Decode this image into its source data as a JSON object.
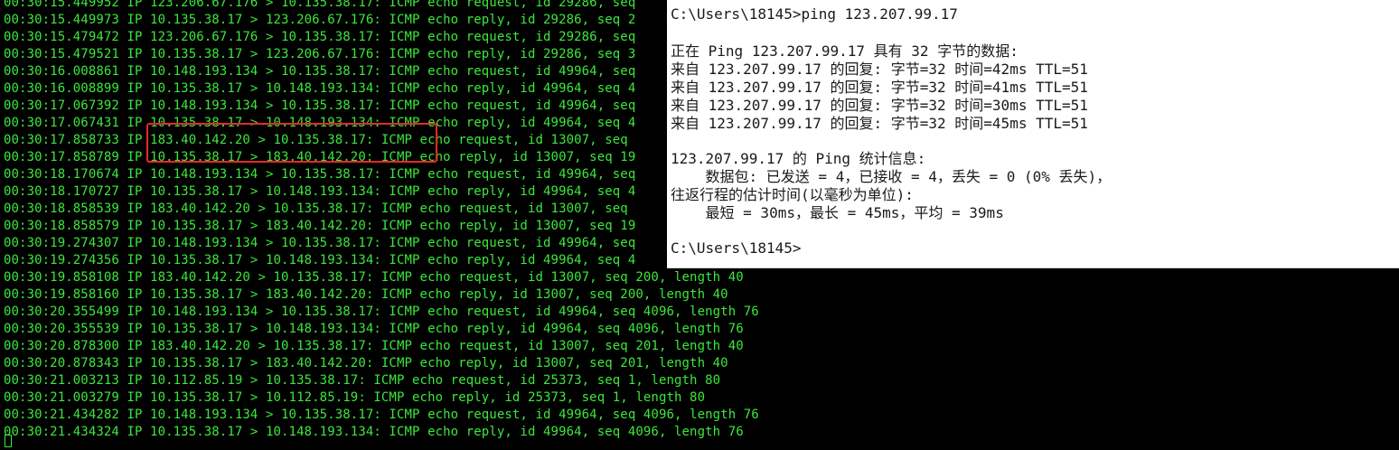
{
  "terminal": {
    "lines": [
      "00:30:15.449952 IP 123.206.67.176 > 10.135.38.17: ICMP echo request, id 29286, seq",
      "00:30:15.449973 IP 10.135.38.17 > 123.206.67.176: ICMP echo reply, id 29286, seq 2",
      "00:30:15.479472 IP 123.206.67.176 > 10.135.38.17: ICMP echo request, id 29286, seq",
      "00:30:15.479521 IP 10.135.38.17 > 123.206.67.176: ICMP echo reply, id 29286, seq 3",
      "00:30:16.008861 IP 10.148.193.134 > 10.135.38.17: ICMP echo request, id 49964, seq",
      "00:30:16.008899 IP 10.135.38.17 > 10.148.193.134: ICMP echo reply, id 49964, seq 4",
      "00:30:17.067392 IP 10.148.193.134 > 10.135.38.17: ICMP echo request, id 49964, seq",
      "00:30:17.067431 IP 10.135.38.17 > 10.148.193.134: ICMP echo reply, id 49964, seq 4",
      "00:30:17.858733 IP 183.40.142.20 > 10.135.38.17: ICMP echo request, id 13007, seq",
      "00:30:17.858789 IP 10.135.38.17 > 183.40.142.20: ICMP echo reply, id 13007, seq 19",
      "00:30:18.170674 IP 10.148.193.134 > 10.135.38.17: ICMP echo request, id 49964, seq",
      "00:30:18.170727 IP 10.135.38.17 > 10.148.193.134: ICMP echo reply, id 49964, seq 4",
      "00:30:18.858539 IP 183.40.142.20 > 10.135.38.17: ICMP echo request, id 13007, seq",
      "00:30:18.858579 IP 10.135.38.17 > 183.40.142.20: ICMP echo reply, id 13007, seq 19",
      "00:30:19.274307 IP 10.148.193.134 > 10.135.38.17: ICMP echo request, id 49964, seq",
      "00:30:19.274356 IP 10.135.38.17 > 10.148.193.134: ICMP echo reply, id 49964, seq 4",
      "00:30:19.858108 IP 183.40.142.20 > 10.135.38.17: ICMP echo request, id 13007, seq 200, length 40",
      "00:30:19.858160 IP 10.135.38.17 > 183.40.142.20: ICMP echo reply, id 13007, seq 200, length 40",
      "00:30:20.355499 IP 10.148.193.134 > 10.135.38.17: ICMP echo request, id 49964, seq 4096, length 76",
      "00:30:20.355539 IP 10.135.38.17 > 10.148.193.134: ICMP echo reply, id 49964, seq 4096, length 76",
      "00:30:20.878300 IP 183.40.142.20 > 10.135.38.17: ICMP echo request, id 13007, seq 201, length 40",
      "00:30:20.878343 IP 10.135.38.17 > 183.40.142.20: ICMP echo reply, id 13007, seq 201, length 40",
      "00:30:21.003213 IP 10.112.85.19 > 10.135.38.17: ICMP echo request, id 25373, seq 1, length 80",
      "00:30:21.003279 IP 10.135.38.17 > 10.112.85.19: ICMP echo reply, id 25373, seq 1, length 80",
      "00:30:21.434282 IP 10.148.193.134 > 10.135.38.17: ICMP echo request, id 49964, seq 4096, length 76",
      "00:30:21.434324 IP 10.135.38.17 > 10.148.193.134: ICMP echo reply, id 49964, seq 4096, length 76"
    ],
    "text_color": "#3ce73c",
    "highlight_color": "#e8272a"
  },
  "cmd_window": {
    "lines": [
      "C:\\Users\\18145>ping 123.207.99.17",
      "",
      "正在 Ping 123.207.99.17 具有 32 字节的数据:",
      "来自 123.207.99.17 的回复: 字节=32 时间=42ms TTL=51",
      "来自 123.207.99.17 的回复: 字节=32 时间=41ms TTL=51",
      "来自 123.207.99.17 的回复: 字节=32 时间=30ms TTL=51",
      "来自 123.207.99.17 的回复: 字节=32 时间=45ms TTL=51",
      "",
      "123.207.99.17 的 Ping 统计信息:",
      "    数据包: 已发送 = 4，已接收 = 4，丢失 = 0 (0% 丢失)，",
      "往返行程的估计时间(以毫秒为单位):",
      "    最短 = 30ms，最长 = 45ms，平均 = 39ms",
      "",
      "C:\\Users\\18145>"
    ]
  }
}
